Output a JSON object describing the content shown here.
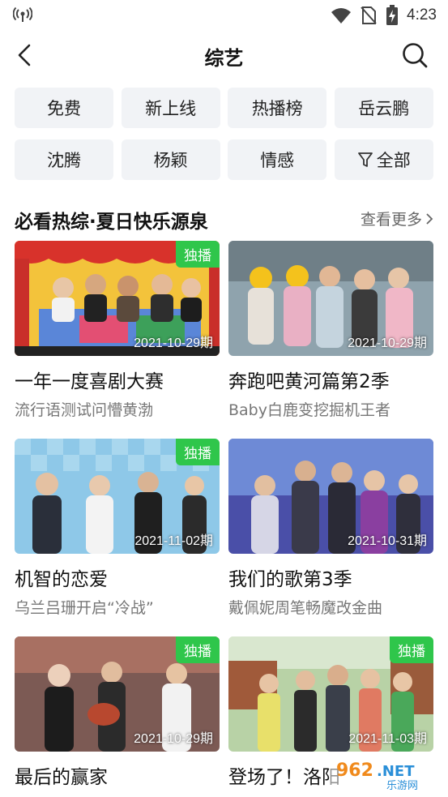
{
  "status_bar": {
    "time": "4:23"
  },
  "header": {
    "title": "综艺"
  },
  "filters": [
    "免费",
    "新上线",
    "热播榜",
    "岳云鹏",
    "沈腾",
    "杨颖",
    "情感",
    "全部"
  ],
  "section": {
    "title": "必看热综·夏日快乐源泉",
    "more": "查看更多"
  },
  "cards": [
    {
      "badge": "独播",
      "date": "2021-10-29期",
      "title": "一年一度喜剧大赛",
      "subtitle": "流行语测试问懵黄渤"
    },
    {
      "badge": "",
      "date": "2021-10-29期",
      "title": "奔跑吧黄河篇第2季",
      "subtitle": "Baby白鹿变挖掘机王者"
    },
    {
      "badge": "独播",
      "date": "2021-11-02期",
      "title": "机智的恋爱",
      "subtitle": "乌兰吕珊开启“冷战”"
    },
    {
      "badge": "",
      "date": "2021-10-31期",
      "title": "我们的歌第3季",
      "subtitle": "戴佩妮周笔畅魔改金曲"
    },
    {
      "badge": "独播",
      "date": "2021-10-29期",
      "title": "最后的赢家",
      "subtitle": ""
    },
    {
      "badge": "独播",
      "date": "2021-11-03期",
      "title": "登场了！洛阳",
      "subtitle": ""
    }
  ],
  "watermark": {
    "text": "962.NET",
    "sub": "乐游网"
  },
  "colors": {
    "badge_green": "#2fc64b",
    "chip_bg": "#f1f3f6"
  }
}
